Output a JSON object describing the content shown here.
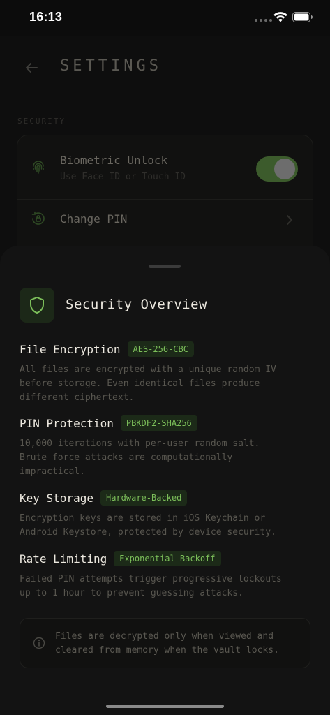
{
  "status_bar": {
    "time": "16:13"
  },
  "header": {
    "title": "SETTINGS"
  },
  "security_section": {
    "label": "SECURITY",
    "biometric": {
      "title": "Biometric Unlock",
      "subtitle": "Use Face ID or Touch ID",
      "enabled": true
    },
    "change_pin": {
      "title": "Change PIN"
    }
  },
  "sheet": {
    "title": "Security Overview",
    "features": [
      {
        "title": "File Encryption",
        "badge": "AES-256-CBC",
        "description": "All files are encrypted with a unique random IV\nbefore storage. Even identical files produce\ndifferent ciphertext."
      },
      {
        "title": "PIN Protection",
        "badge": "PBKDF2-SHA256",
        "description": "10,000 iterations with per-user random salt.\nBrute force attacks are computationally\nimpractical."
      },
      {
        "title": "Key Storage",
        "badge": "Hardware-Backed",
        "description": "Encryption keys are stored in iOS Keychain or\nAndroid Keystore, protected by device security."
      },
      {
        "title": "Rate Limiting",
        "badge": "Exponential Backoff",
        "description": "Failed PIN attempts trigger progressive lockouts\nup to 1 hour to prevent guessing attacks."
      }
    ],
    "info": "Files are decrypted only when viewed and\ncleared from memory when the vault locks."
  },
  "colors": {
    "accent": "#7cbf5a",
    "badge_bg": "#1c2a18",
    "sheet_bg": "#131313",
    "background": "#0c0c0c"
  }
}
